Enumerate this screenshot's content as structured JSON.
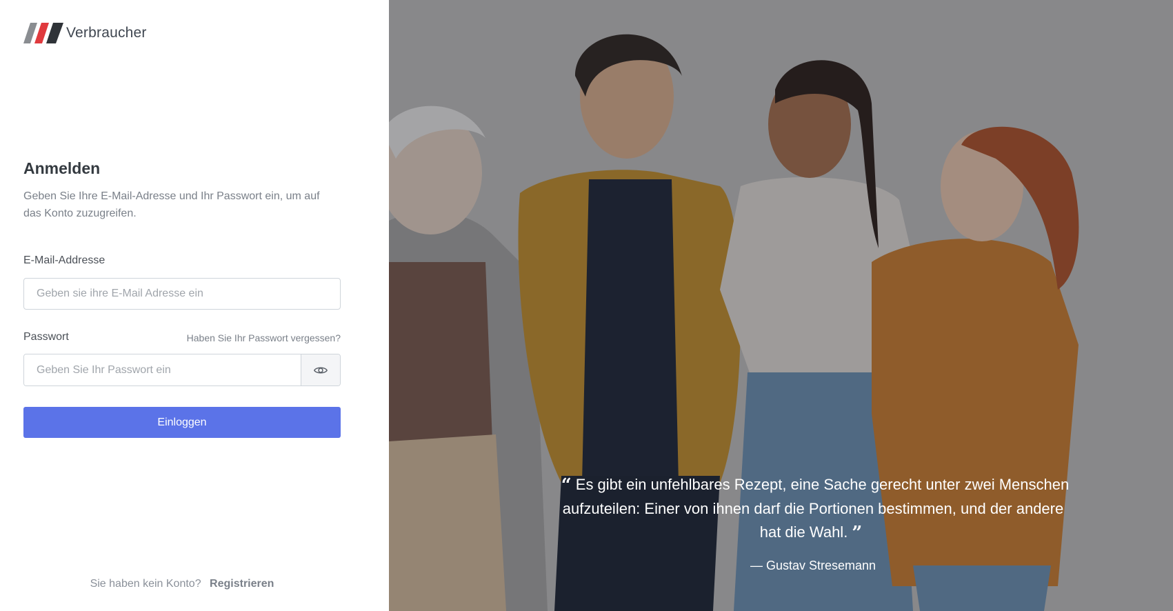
{
  "brand": {
    "name": "Verbraucher"
  },
  "login": {
    "title": "Anmelden",
    "subtitle": "Geben Sie Ihre E-Mail-Adresse und Ihr Passwort ein, um auf das Konto zuzugreifen.",
    "email_label": "E-Mail-Addresse",
    "email_placeholder": "Geben sie ihre E-Mail Adresse ein",
    "email_value": "",
    "password_label": "Passwort",
    "forgot_link": "Haben Sie Ihr Passwort vergessen?",
    "password_placeholder": "Geben Sie Ihr Passwort ein",
    "password_value": "",
    "toggle_icon": "eye-icon",
    "submit_label": "Einloggen",
    "accent_color": "#5b73e8"
  },
  "signup": {
    "prompt": "Sie haben kein Konto?",
    "link": "Registrieren"
  },
  "hero": {
    "quote": "Es gibt ein unfehlbares Rezept, eine Sache gerecht unter zwei Menschen aufzuteilen: Einer von ihnen darf die Portionen bestimmen, und der andere hat die Wahl.",
    "author": "— Gustav Stresemann"
  }
}
